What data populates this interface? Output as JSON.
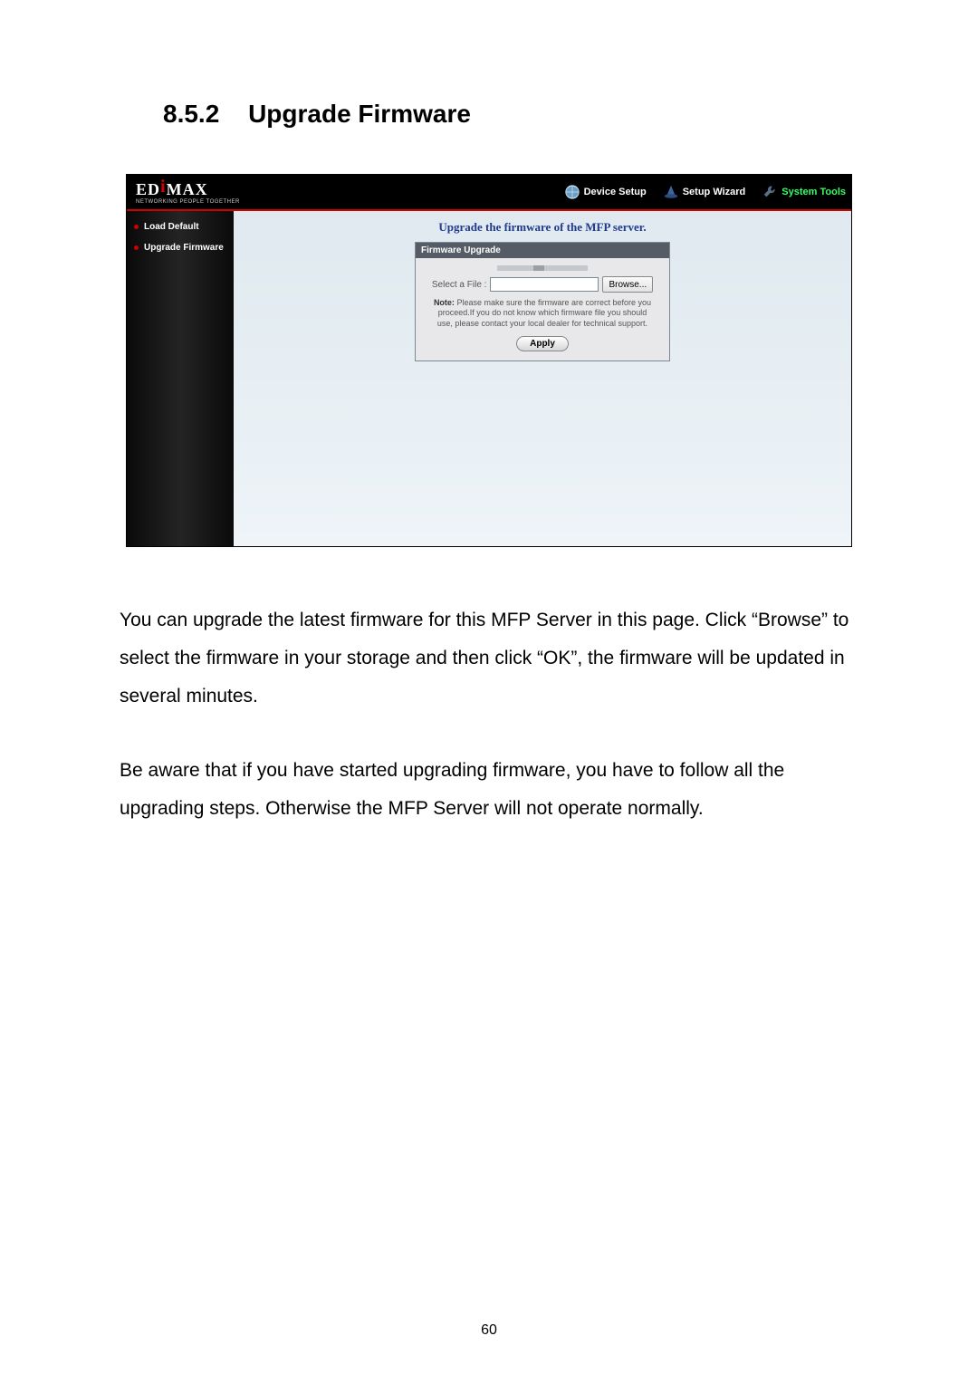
{
  "heading": {
    "number": "8.5.2",
    "title": "Upgrade Firmware"
  },
  "screenshot": {
    "brand_logo": "EDIMAX",
    "brand_tagline": "NETWORKING PEOPLE TOGETHER",
    "topnav": {
      "device_setup": "Device Setup",
      "setup_wizard": "Setup Wizard",
      "system_tools": "System Tools"
    },
    "sidebar": {
      "load_default": "Load Default",
      "upgrade_firmware": "Upgrade Firmware"
    },
    "page_title": "Upgrade the firmware of the MFP server.",
    "panel_header": "Firmware Upgrade",
    "file_label": "Select a File :",
    "browse_label": "Browse...",
    "note_bold": "Note:",
    "note_text": " Please make sure the firmware are correct before you proceed.If you do not know which firmware file you should use, please contact your local dealer for technical support.",
    "apply_label": "Apply"
  },
  "paragraphs": {
    "p1": "You can upgrade the latest firmware for this MFP Server in this page. Click “Browse” to select the firmware in your storage and then click “OK”, the firmware will be updated in several minutes.",
    "p2": "Be aware that if you have started upgrading firmware, you have to follow all the upgrading steps. Otherwise the MFP Server will not operate normally."
  },
  "page_number": "60"
}
